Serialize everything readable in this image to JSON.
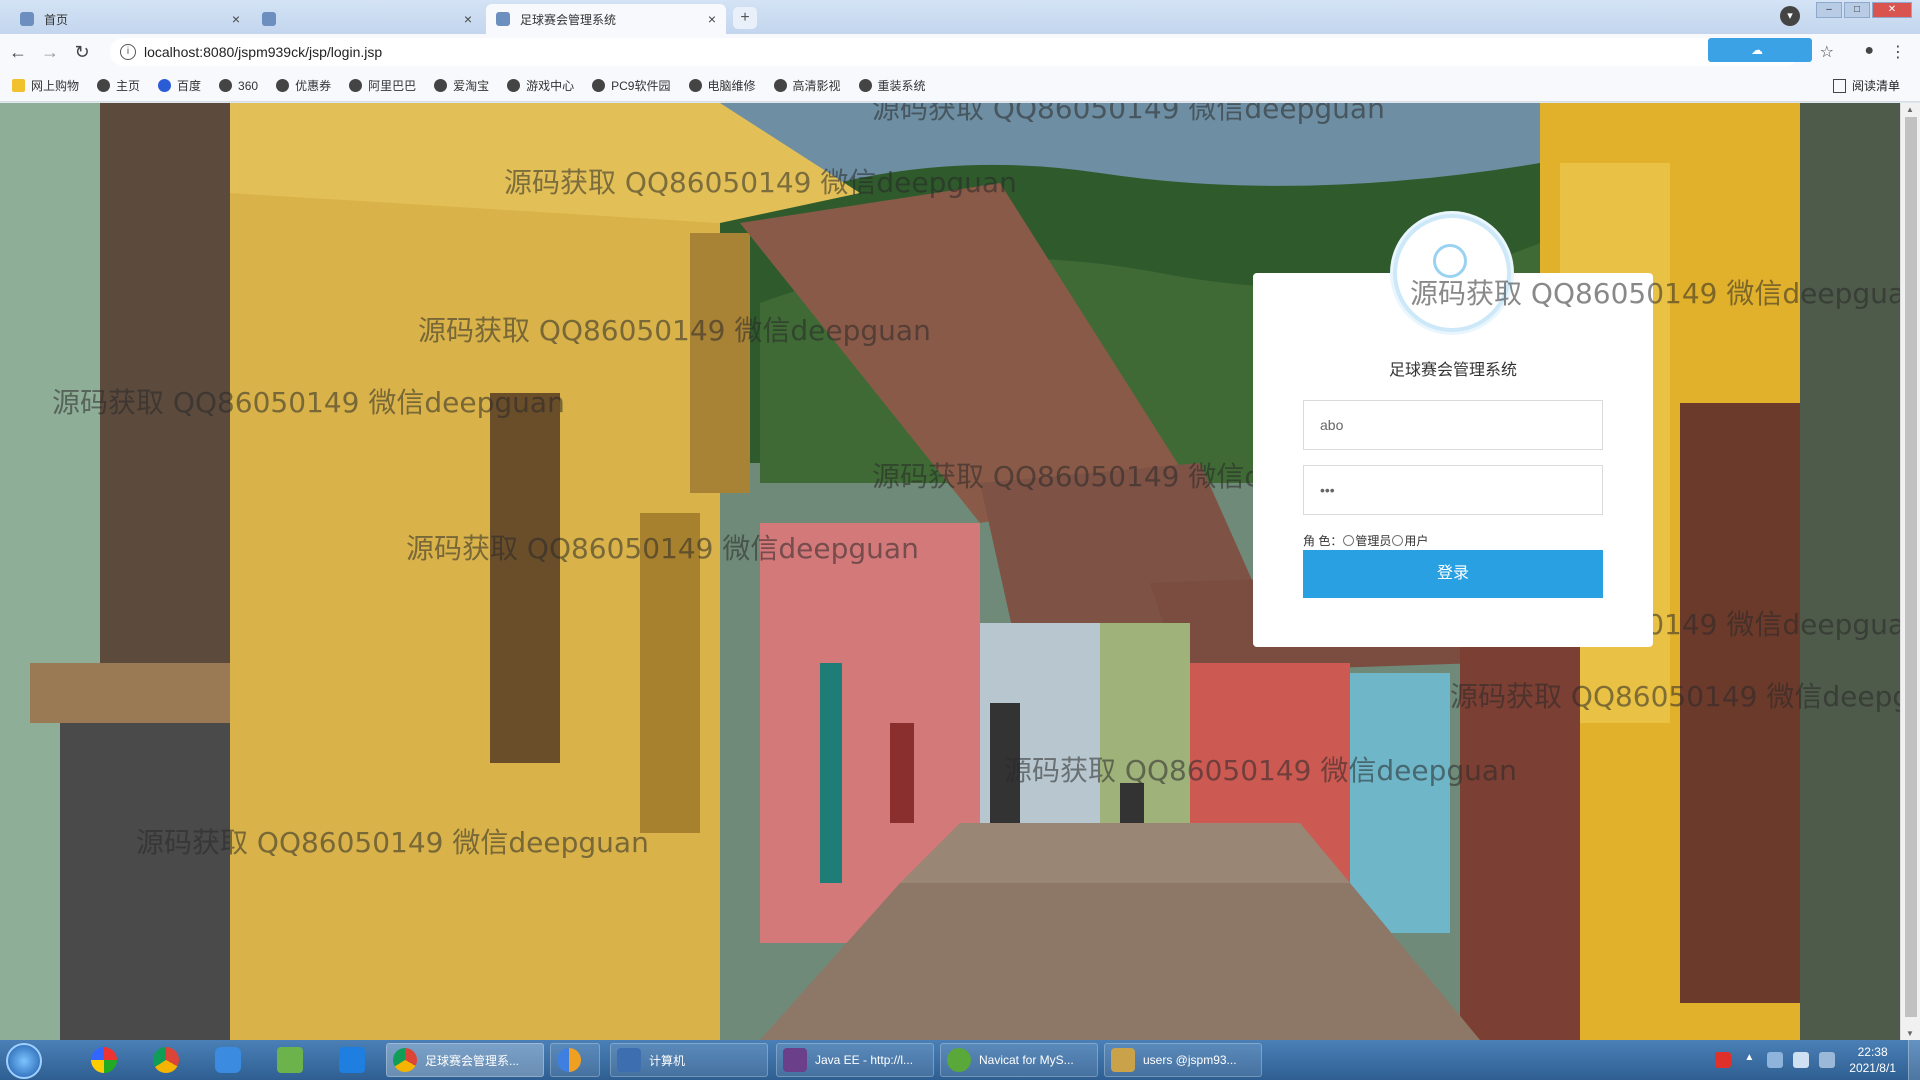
{
  "browser": {
    "tabs": [
      {
        "label": "首页",
        "active": false
      },
      {
        "label": "",
        "active": false
      },
      {
        "label": "足球赛会管理系统",
        "active": true
      }
    ],
    "url": "localhost:8080/jspm939ck/jsp/login.jsp",
    "extension_label": "",
    "bookmarks": [
      {
        "label": "网上购物",
        "icon": "folder-icon"
      },
      {
        "label": "主页",
        "icon": "globe-icon"
      },
      {
        "label": "百度",
        "icon": "baidu-paw-icon"
      },
      {
        "label": "360",
        "icon": "globe-icon"
      },
      {
        "label": "优惠券",
        "icon": "globe-icon"
      },
      {
        "label": "阿里巴巴",
        "icon": "globe-icon"
      },
      {
        "label": "爱淘宝",
        "icon": "globe-icon"
      },
      {
        "label": "游戏中心",
        "icon": "globe-icon"
      },
      {
        "label": "PC9软件园",
        "icon": "globe-icon"
      },
      {
        "label": "电脑维修",
        "icon": "globe-icon"
      },
      {
        "label": "高清影视",
        "icon": "globe-icon"
      },
      {
        "label": "重装系统",
        "icon": "globe-icon"
      }
    ],
    "reading_list": "阅读清单"
  },
  "login": {
    "title": "足球赛会管理系统",
    "username_value": "abo",
    "password_value": "•••",
    "role_label": "角 色：",
    "roles": [
      "管理员",
      "用户"
    ],
    "submit": "登录"
  },
  "watermark_text": "源码获取 QQ86050149 微信deepguan",
  "taskbar": {
    "tasks": [
      {
        "label": "足球赛会管理系...",
        "active": true,
        "color": "#d9433a"
      },
      {
        "label": "",
        "active": false,
        "color": "#f0a020"
      },
      {
        "label": "计算机",
        "active": false,
        "color": "#3d6fb0"
      },
      {
        "label": "Java EE - http://l...",
        "active": false,
        "color": "#6b3f8a"
      },
      {
        "label": "Navicat for MyS...",
        "active": false,
        "color": "#5aa83a"
      },
      {
        "label": "users @jspm93...",
        "active": false,
        "color": "#c9a24a"
      }
    ],
    "time": "22:38",
    "date": "2021/8/1"
  }
}
